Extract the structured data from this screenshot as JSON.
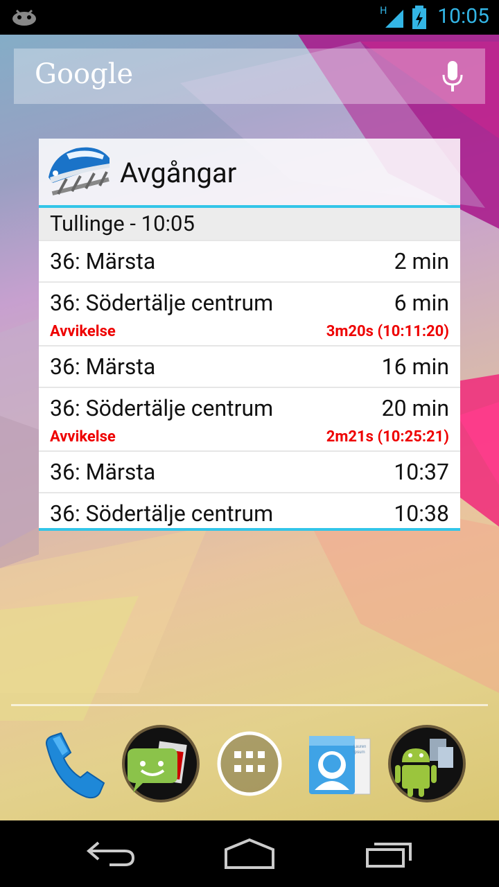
{
  "status_bar": {
    "network_type": "H",
    "time": "10:05"
  },
  "search_bar": {
    "logo": "Google",
    "mic_icon": "microphone-icon"
  },
  "widget": {
    "title": "Avgångar",
    "station": "Tullinge - 10:05",
    "departures": [
      {
        "line": "36: Märsta",
        "time": "2 min",
        "deviation": "",
        "deviation_time": ""
      },
      {
        "line": "36: Södertälje centrum",
        "time": "6 min",
        "deviation": "Avvikelse",
        "deviation_time": "3m20s (10:11:20)"
      },
      {
        "line": "36: Märsta",
        "time": "16 min",
        "deviation": "",
        "deviation_time": ""
      },
      {
        "line": "36: Södertälje centrum",
        "time": "20 min",
        "deviation": "Avvikelse",
        "deviation_time": "2m21s (10:25:21)"
      },
      {
        "line": "36: Märsta",
        "time": "10:37",
        "deviation": "",
        "deviation_time": ""
      },
      {
        "line": "36: Södertälje centrum",
        "time": "10:38",
        "deviation": "",
        "deviation_time": ""
      }
    ]
  },
  "dock": {
    "icons": [
      "phone-icon",
      "messaging-icon",
      "app-drawer-icon",
      "contacts-icon",
      "android-apps-icon"
    ],
    "contacts_card_text": "Lauren Ipsum"
  },
  "colors": {
    "accent": "#33c5e8",
    "deviation": "#e00000",
    "status_blue": "#33b5e5"
  }
}
